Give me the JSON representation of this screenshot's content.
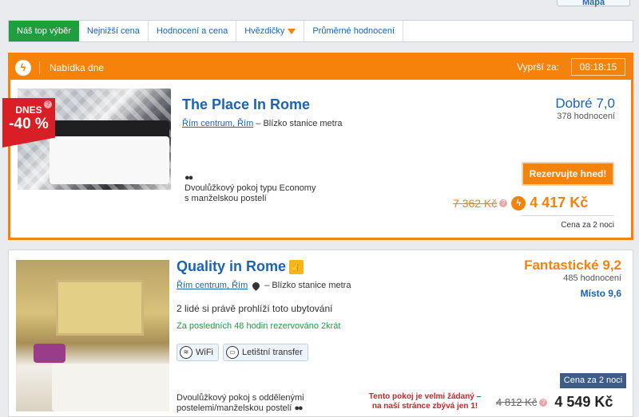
{
  "top": {
    "map_label": "Mapa"
  },
  "tabs": [
    {
      "label": "Náš top výběr",
      "active": true
    },
    {
      "label": "Nejnižší cena"
    },
    {
      "label": "Hodnocení a cena"
    },
    {
      "label": "Hvězdičky",
      "has_dropdown": true
    },
    {
      "label": "Průměrné hodnocení"
    }
  ],
  "deal": {
    "header_label": "Nabídka dne",
    "expires_label": "Vyprší za:",
    "timer": "08:18:15",
    "badge_top": "DNES",
    "badge_discount": "-40 %",
    "hotel_name": "The Place In Rome",
    "location_link": "Řím centrum, Řím",
    "location_note": "– Blízko stanice metra",
    "rating_label": "Dobré 7,0",
    "review_count": "378 hodnocení",
    "reserve_button": "Rezervujte hned!",
    "room_line1": "Dvoulůžkový pokoj typu Economy",
    "room_line2": "s manželskou postelí",
    "old_price": "7 362 Kč",
    "new_price": "4 417 Kč",
    "price_note": "Cena za 2 noci",
    "accent_color": "#f5820a"
  },
  "hotel2": {
    "hotel_name": "Quality in Rome",
    "location_link": "Řím centrum, Řím",
    "location_note": "– Blízko stanice metra",
    "rating_label": "Fantastické 9,2",
    "review_count": "485 hodnocení",
    "place_label": "Místo 9,6",
    "viewers": "2 lidé si právě prohlíží toto ubytování",
    "booked": "Za posledních 48 hodin rezervováno 2krát",
    "amenities": [
      "WiFi",
      "Letištní transfer"
    ],
    "price_note": "Cena za 2 noci",
    "room_line1": "Dvoulůžkový pokoj s oddělenými",
    "room_line2": "postelemi/manželskou postelí",
    "warn_line1": "Tento pokoj je velmi žádaný –",
    "warn_line2": "na naší stránce zbývá jen 1!",
    "old_price": "4 812 Kč",
    "new_price": "4 549 Kč"
  }
}
